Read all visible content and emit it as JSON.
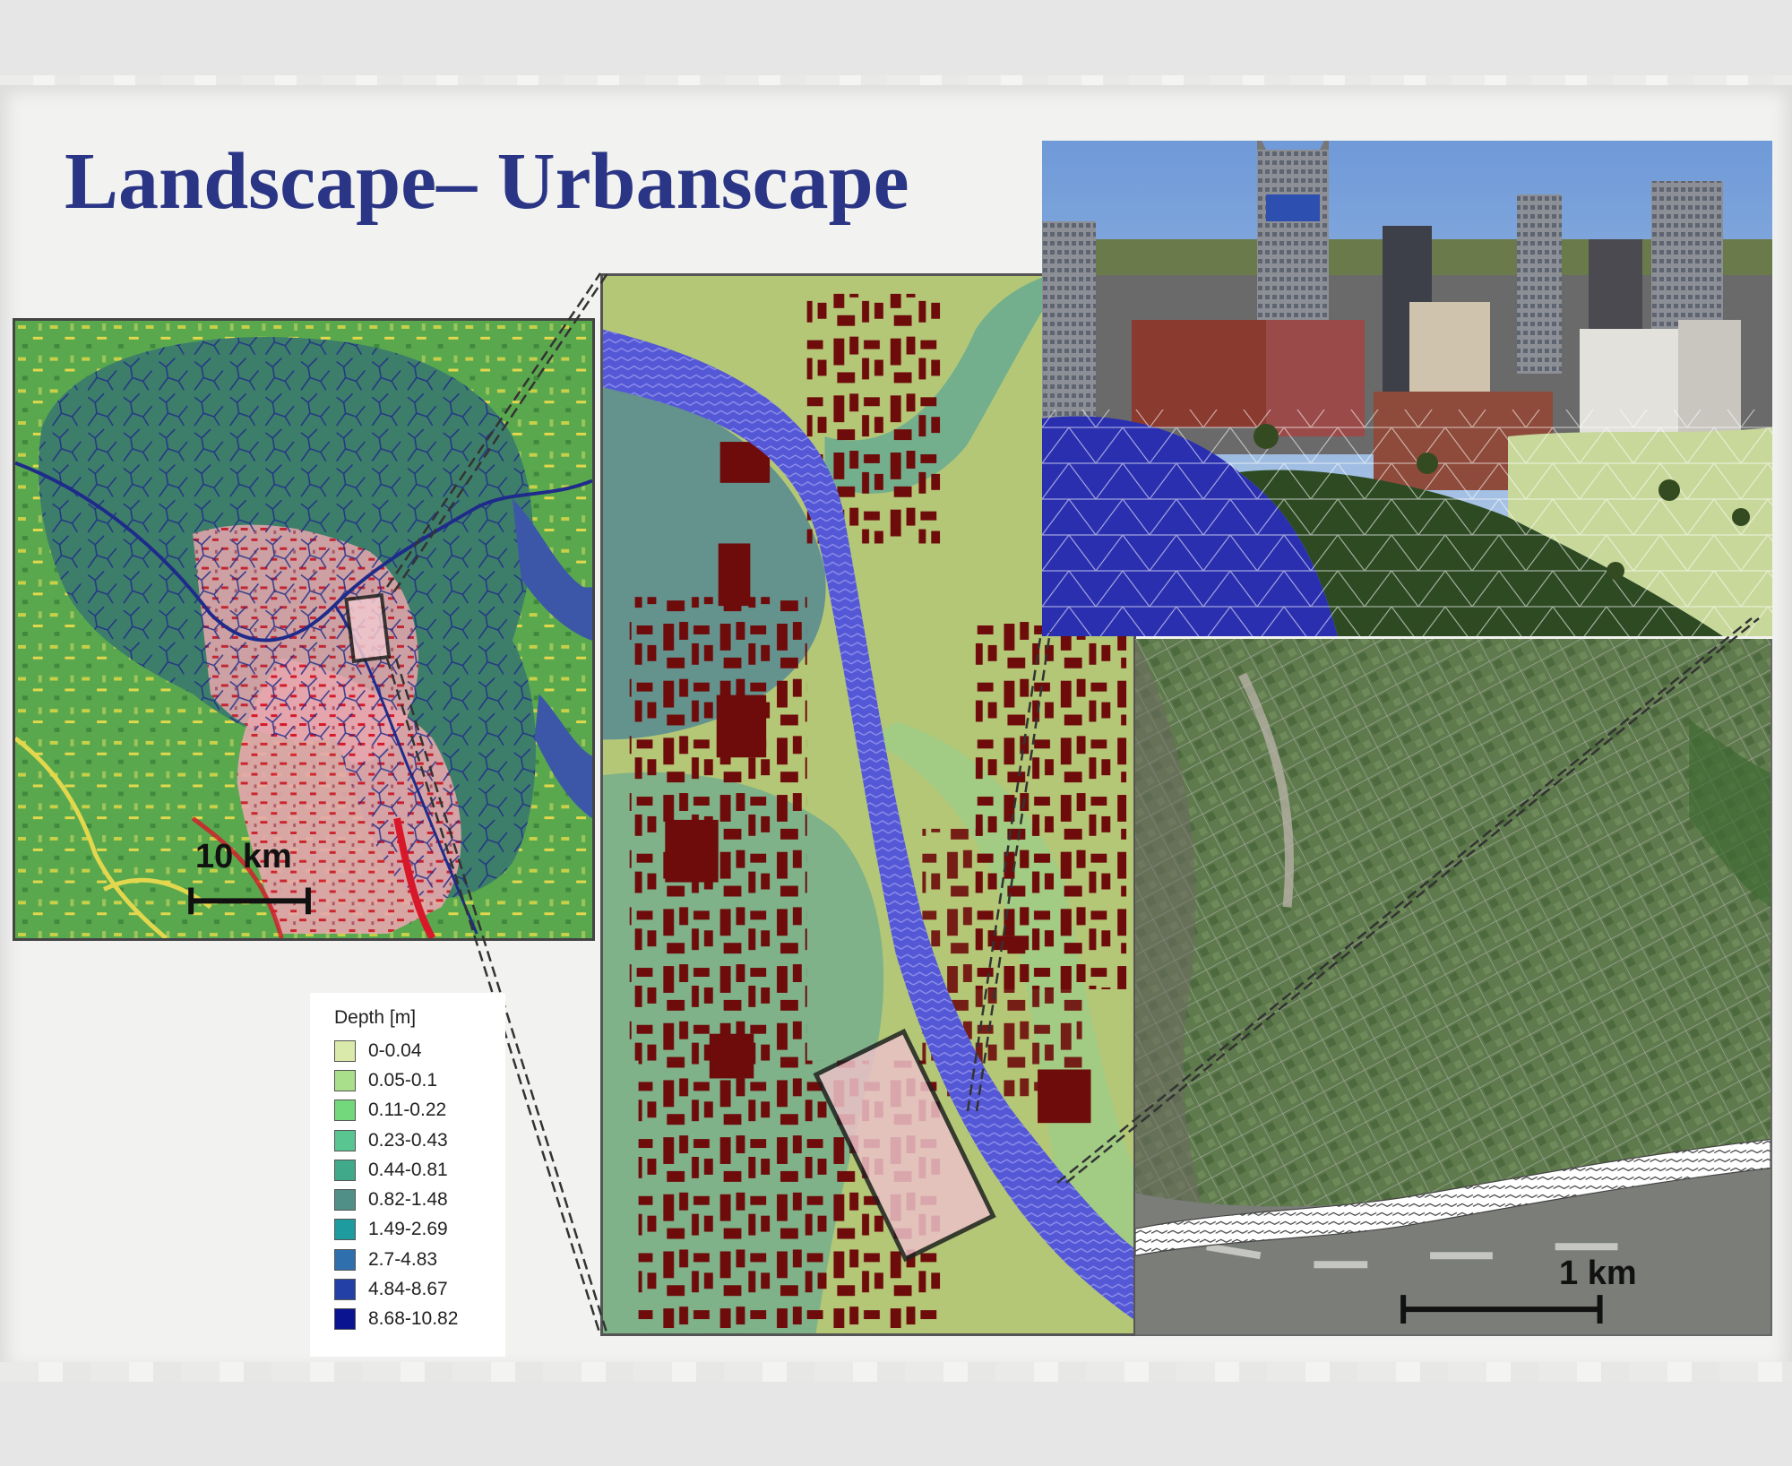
{
  "title": "Landscape– Urbanscape",
  "scale_bars": {
    "landscape": "10 km",
    "urban": "1 km"
  },
  "legend": {
    "title": "Depth [m]",
    "classes": [
      {
        "label": "0-0.04",
        "color": "#d9eaaa"
      },
      {
        "label": "0.05-0.1",
        "color": "#a9df8a"
      },
      {
        "label": "0.11-0.22",
        "color": "#73d87c"
      },
      {
        "label": "0.23-0.43",
        "color": "#59c590"
      },
      {
        "label": "0.44-0.81",
        "color": "#3fa98a"
      },
      {
        "label": "0.82-1.48",
        "color": "#4f8f88"
      },
      {
        "label": "1.49-2.69",
        "color": "#1d9b9e"
      },
      {
        "label": "2.7-4.83",
        "color": "#2f6fae"
      },
      {
        "label": "4.84-8.67",
        "color": "#2240a6"
      },
      {
        "label": "8.68-10.82",
        "color": "#0a1490"
      }
    ]
  },
  "colors": {
    "title": "#2a3585",
    "building": "#6e0b0b",
    "river": "#5558d6",
    "stream_network": "#1f2b8a",
    "urban_landcover": "#d8172a"
  }
}
